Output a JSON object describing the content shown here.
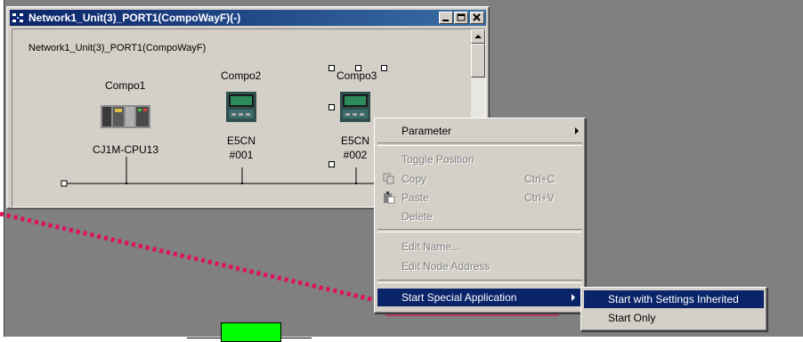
{
  "window": {
    "title": "Network1_Unit(3)_PORT1(CompoWayF)(-)",
    "network_label": "Network1_Unit(3)_PORT1(CompoWayF)",
    "controls": [
      "minimize",
      "maximize",
      "close"
    ]
  },
  "nodes": [
    {
      "name": "Compo1",
      "model": "CJ1M-CPU13",
      "address": ""
    },
    {
      "name": "Compo2",
      "model": "E5CN",
      "address": "#001"
    },
    {
      "name": "Compo3",
      "model": "E5CN",
      "address": "#002"
    }
  ],
  "context_menu": {
    "items": [
      {
        "label": "Parameter",
        "shortcut": "",
        "disabled": false,
        "submenu": true
      },
      {
        "label": "Toggle Position",
        "shortcut": "",
        "disabled": true
      },
      {
        "label": "Copy",
        "shortcut": "Ctrl+C",
        "disabled": true,
        "icon": "copy-icon"
      },
      {
        "label": "Paste",
        "shortcut": "Ctrl+V",
        "disabled": true,
        "icon": "paste-icon"
      },
      {
        "label": "Delete",
        "shortcut": "",
        "disabled": true
      },
      {
        "label": "Edit Name...",
        "shortcut": "",
        "disabled": true
      },
      {
        "label": "Edit Node Address",
        "shortcut": "",
        "disabled": true
      },
      {
        "label": "Start Special Application",
        "shortcut": "",
        "disabled": false,
        "submenu": true,
        "highlighted": true
      }
    ]
  },
  "submenu": {
    "items": [
      {
        "label": "Start with Settings Inherited",
        "highlighted": true
      },
      {
        "label": "Start Only",
        "highlighted": false
      }
    ]
  },
  "colors": {
    "title_bar": "#0a246a",
    "highlight": "#0a246a",
    "annotation_dots": "#e0105f",
    "underline_mark": "#e0105f",
    "green_box": "#00ff00"
  }
}
